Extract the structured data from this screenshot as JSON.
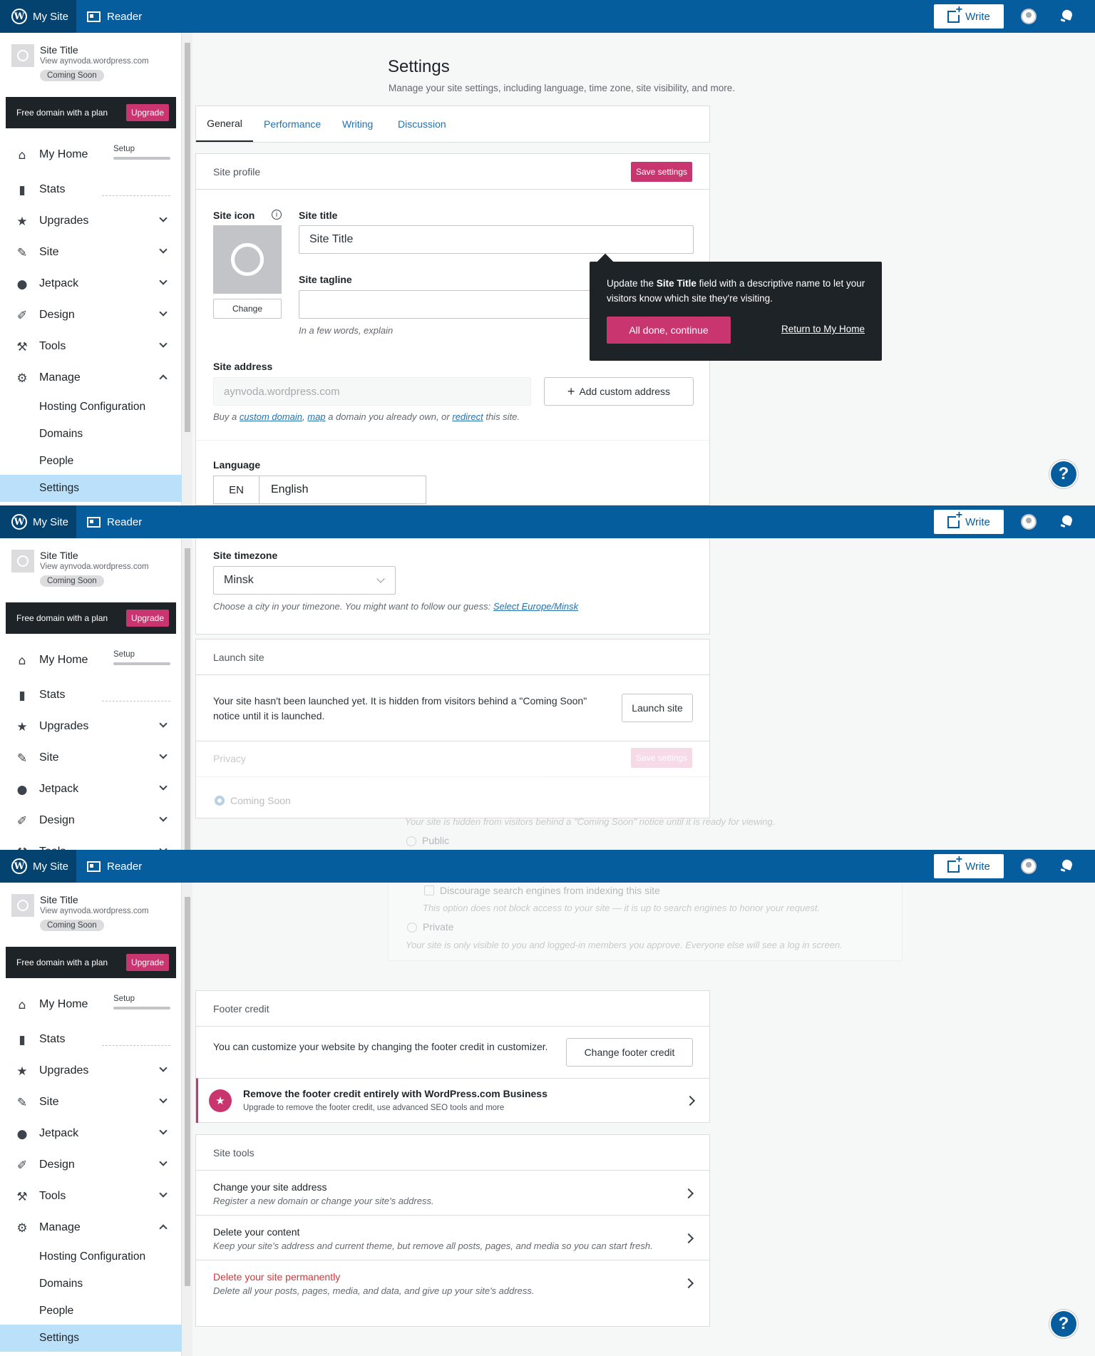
{
  "masterbar": {
    "my_site": "My Site",
    "reader": "Reader",
    "write": "Write"
  },
  "sidebar": {
    "site_title": "Site Title",
    "site_url": "View aynvoda.wordpress.com",
    "badge": "Coming Soon",
    "domain_banner": "Free domain with a plan",
    "upgrade": "Upgrade",
    "setup_label": "Setup",
    "setup_progress": 0.15,
    "items": [
      {
        "label": "My Home",
        "icon": "home-icon"
      },
      {
        "label": "Stats",
        "icon": "stats-icon"
      },
      {
        "label": "Upgrades",
        "icon": "star-icon"
      },
      {
        "label": "Site",
        "icon": "pencil-icon"
      },
      {
        "label": "Jetpack",
        "icon": "jetpack-icon"
      },
      {
        "label": "Design",
        "icon": "design-icon"
      },
      {
        "label": "Tools",
        "icon": "wrench-icon"
      },
      {
        "label": "Manage",
        "icon": "gear-icon"
      }
    ],
    "manage_items": [
      "Hosting Configuration",
      "Domains",
      "People",
      "Settings"
    ]
  },
  "settings": {
    "title": "Settings",
    "subtitle": "Manage your site settings, including language, time zone, site visibility, and more.",
    "tabs": [
      "General",
      "Performance",
      "Writing",
      "Discussion"
    ],
    "site_profile": {
      "header": "Site profile",
      "save": "Save settings",
      "site_icon_label": "Site icon",
      "change": "Change",
      "site_title_label": "Site title",
      "site_title_value": "Site Title",
      "site_tagline_label": "Site tagline",
      "tagline_help": "In a few words, explain",
      "site_address_label": "Site address",
      "site_address_value": "aynvoda.wordpress.com",
      "add_custom_address": "Add custom address",
      "address_help_pre": "Buy a",
      "address_help_custom": "custom domain",
      "address_help_map": "map",
      "address_help_mid": "a domain you already own, or",
      "address_help_redirect": "redirect",
      "address_help_post": "this site.",
      "language_label": "Language",
      "language_code": "EN",
      "language_name": "English",
      "timezone_label": "Site timezone",
      "timezone_value": "Minsk",
      "timezone_help": "Choose a city in your timezone. You might want to follow our guess:",
      "timezone_link": "Select Europe/Minsk"
    },
    "tooltip": {
      "text_pre": "Update the",
      "text_bold": "Site Title",
      "text_post": "field with a descriptive name to let your visitors know which site they're visiting.",
      "primary": "All done, continue",
      "secondary": "Return to My Home"
    },
    "launch": {
      "header": "Launch site",
      "text": "Your site hasn't been launched yet. It is hidden from visitors behind a \"Coming Soon\" notice until it is launched.",
      "button": "Launch site"
    },
    "privacy": {
      "header": "Privacy",
      "save": "Save settings",
      "coming_soon": "Coming Soon",
      "coming_soon_desc": "Your site is hidden from visitors behind a \"Coming Soon\" notice until it is ready for viewing.",
      "public": "Public",
      "discourage": "Discourage search engines from indexing this site",
      "discourage_desc": "This option does not block access to your site — it is up to search engines to honor your request.",
      "private": "Private",
      "private_desc": "Your site is only visible to you and logged-in members you approve. Everyone else will see a log in screen."
    },
    "footer_credit": {
      "header": "Footer credit",
      "text": "You can customize your website by changing the footer credit in customizer.",
      "button": "Change footer credit",
      "upsell_title": "Remove the footer credit entirely with WordPress.com Business",
      "upsell_desc": "Upgrade to remove the footer credit, use advanced SEO tools and more"
    },
    "site_tools": {
      "header": "Site tools",
      "items": [
        {
          "title": "Change your site address",
          "desc": "Register a new domain or change your site's address."
        },
        {
          "title": "Delete your content",
          "desc": "Keep your site's address and current theme, but remove all posts, pages, and media so you can start fresh."
        },
        {
          "title": "Delete your site permanently",
          "desc": "Delete all your posts, pages, media, and data, and give up your site's address."
        }
      ]
    }
  },
  "help": "?",
  "colors": {
    "masterbar": "#065d9d",
    "accent": "#c9356e",
    "active_nav": "#bbe0fa",
    "danger": "#d63638"
  }
}
